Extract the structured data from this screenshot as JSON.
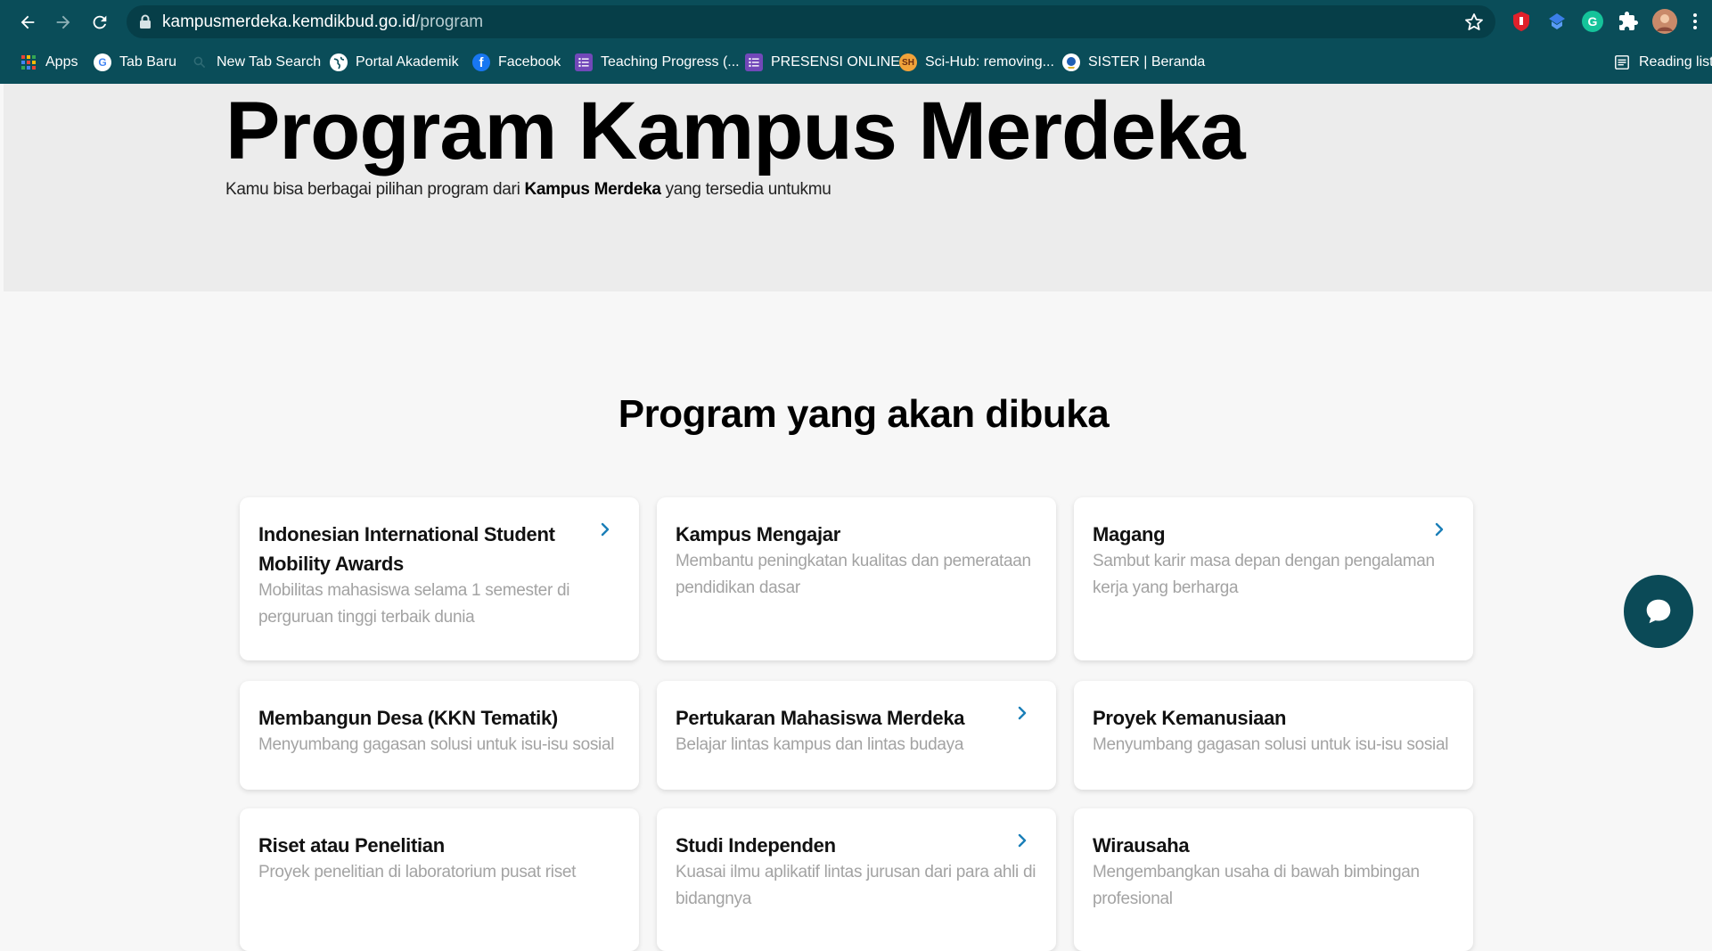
{
  "browser": {
    "url_host": "kampusmerdeka.kemdikbud.go.id",
    "url_path": "/program",
    "bookmarks": [
      {
        "label": "Apps",
        "icon": "apps-grid-icon"
      },
      {
        "label": "Tab Baru",
        "icon": "google-icon"
      },
      {
        "label": "New Tab Search",
        "icon": "search-icon"
      },
      {
        "label": "Portal Akademik",
        "icon": "globe-icon"
      },
      {
        "label": "Facebook",
        "icon": "facebook-icon"
      },
      {
        "label": "Teaching Progress (...",
        "icon": "forms-icon"
      },
      {
        "label": "PRESENSI ONLINE",
        "icon": "forms-icon"
      },
      {
        "label": "Sci-Hub: removing...",
        "icon": "scihub-icon"
      },
      {
        "label": "SISTER | Beranda",
        "icon": "kemdikbud-icon"
      }
    ],
    "reading_list": "Reading list"
  },
  "hero": {
    "title": "Program Kampus Merdeka",
    "subtitle_before": "Kamu bisa berbagai pilihan program dari ",
    "subtitle_bold": "Kampus Merdeka",
    "subtitle_after": " yang tersedia untukmu"
  },
  "section": {
    "title": "Program yang akan dibuka"
  },
  "programs": [
    {
      "title": "Indonesian International Student Mobility Awards",
      "desc": "Mobilitas mahasiswa selama 1 semester di perguruan tinggi terbaik dunia",
      "has_arrow": true
    },
    {
      "title": "Kampus Mengajar",
      "desc": "Membantu peningkatan kualitas dan pemerataan pendidikan dasar",
      "has_arrow": false
    },
    {
      "title": "Magang",
      "desc": "Sambut karir masa depan dengan pengalaman kerja yang berharga",
      "has_arrow": true
    },
    {
      "title": "Membangun Desa (KKN Tematik)",
      "desc": "Menyumbang gagasan solusi untuk isu-isu sosial",
      "has_arrow": false
    },
    {
      "title": "Pertukaran Mahasiswa Merdeka",
      "desc": "Belajar lintas kampus dan lintas budaya",
      "has_arrow": true
    },
    {
      "title": "Proyek Kemanusiaan",
      "desc": "Menyumbang gagasan solusi untuk isu-isu sosial",
      "has_arrow": false
    },
    {
      "title": "Riset atau Penelitian",
      "desc": "Proyek penelitian di laboratorium pusat riset",
      "has_arrow": false
    },
    {
      "title": "Studi Independen",
      "desc": "Kuasai ilmu aplikatif lintas jurusan dari para ahli di bidangnya",
      "has_arrow": true
    },
    {
      "title": "Wirausaha",
      "desc": "Mengembangkan usaha di bawah bimbingan profesional",
      "has_arrow": false
    }
  ],
  "colors": {
    "browser_chrome": "#0a4d59",
    "accent_arrow": "#1a7fb8",
    "chat_button": "#0b4a57"
  }
}
